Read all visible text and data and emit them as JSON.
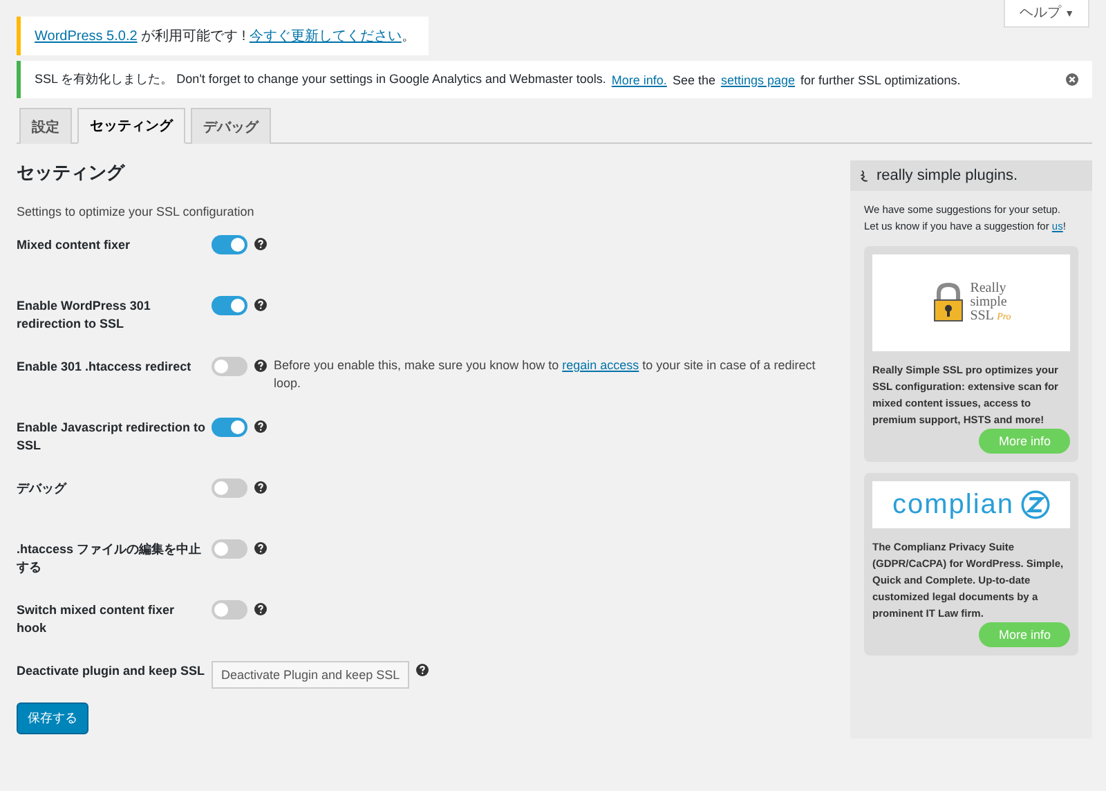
{
  "help_tab": {
    "label": "ヘルプ",
    "caret": "▼"
  },
  "update_notice": {
    "link1": "WordPress 5.0.2",
    "middle": " が利用可能です ! ",
    "link2": "今すぐ更新してください",
    "end": "。"
  },
  "ssl_notice": {
    "text1": "SSL を有効化しました。 Don't forget to change your settings in Google Analytics and Webmaster tools.",
    "link1": "More info.",
    "text2": "See the",
    "link2": "settings page",
    "text3": "for further SSL optimizations."
  },
  "tabs": [
    {
      "label": "設定",
      "selected": false
    },
    {
      "label": "セッティング",
      "selected": true
    },
    {
      "label": "デバッグ",
      "selected": false
    }
  ],
  "heading": "セッティング",
  "subtitle": "Settings to optimize your SSL configuration",
  "settings": [
    {
      "label": "Mixed content fixer",
      "kind": "toggle",
      "on": true
    },
    {
      "label": "Enable WordPress 301 redirection to SSL",
      "kind": "toggle",
      "on": true
    },
    {
      "label": "Enable 301 .htaccess redirect",
      "kind": "toggle",
      "on": false,
      "note": {
        "before": "Before you enable this, make sure you know how to",
        "link": "regain access",
        "after": "to your site in case of a redirect loop."
      }
    },
    {
      "label": "Enable Javascript redirection to SSL",
      "kind": "toggle",
      "on": true
    },
    {
      "label": "デバッグ",
      "kind": "toggle",
      "on": false
    },
    {
      "label": ".htaccess ファイルの編集を中止する",
      "kind": "toggle",
      "on": false
    },
    {
      "label": "Switch mixed content fixer hook",
      "kind": "toggle",
      "on": false
    },
    {
      "label": "Deactivate plugin and keep SSL",
      "kind": "button",
      "button": "Deactivate Plugin and keep SSL"
    }
  ],
  "save_button": "保存する",
  "sidebar": {
    "brand": "really simple plugins.",
    "intro": "We have some suggestions for your setup.",
    "intro2": "Let us know if you have a suggestion for",
    "intro_link": "us",
    "intro_end": "!",
    "cards": [
      {
        "kind": "ssl",
        "logo": [
          "Really",
          "simple",
          "SSL",
          "Pro"
        ],
        "text": "Really Simple SSL pro optimizes your SSL configuration: extensive scan for mixed content issues, access to premium support, HSTS and more!",
        "button": "More info"
      },
      {
        "kind": "complianz",
        "logo": [
          "complian"
        ],
        "text": "The Complianz Privacy Suite (GDPR/CaCPA) for WordPress. Simple, Quick and Complete. Up-to-date customized legal documents by a prominent IT Law firm.",
        "button": "More info"
      }
    ]
  }
}
